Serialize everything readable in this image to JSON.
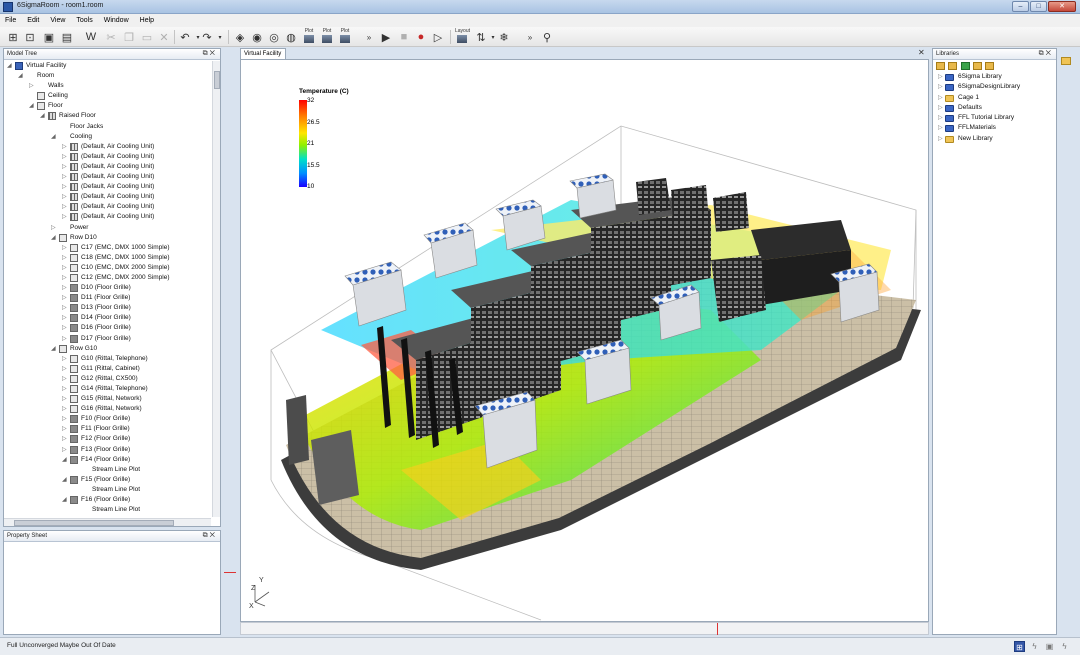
{
  "window": {
    "title": "6SigmaRoom - room1.room"
  },
  "menu": [
    "File",
    "Edit",
    "View",
    "Tools",
    "Window",
    "Help"
  ],
  "toolbar": {
    "plot_labels": [
      "Plot",
      "Plot",
      "Plot"
    ],
    "layout_label": "Layout",
    "more": "»"
  },
  "model_tree": {
    "title": "Model Tree",
    "items": [
      {
        "depth": 0,
        "arrow": "◢",
        "icon": "blue",
        "label": "Virtual Facility"
      },
      {
        "depth": 1,
        "arrow": "◢",
        "icon": "none",
        "label": "Room"
      },
      {
        "depth": 2,
        "arrow": "▷",
        "icon": "none",
        "label": "Walls"
      },
      {
        "depth": 2,
        "arrow": "",
        "icon": "plain",
        "label": "Ceiling"
      },
      {
        "depth": 2,
        "arrow": "◢",
        "icon": "plain",
        "label": "Floor"
      },
      {
        "depth": 3,
        "arrow": "◢",
        "icon": "grid",
        "label": "Raised Floor"
      },
      {
        "depth": 4,
        "arrow": "",
        "icon": "none",
        "label": "Floor Jacks"
      },
      {
        "depth": 4,
        "arrow": "◢",
        "icon": "none",
        "label": "Cooling"
      },
      {
        "depth": 5,
        "arrow": "▷",
        "icon": "grid",
        "label": "(Default, Air Cooling Unit)"
      },
      {
        "depth": 5,
        "arrow": "▷",
        "icon": "grid",
        "label": "(Default, Air Cooling Unit)"
      },
      {
        "depth": 5,
        "arrow": "▷",
        "icon": "grid",
        "label": "(Default, Air Cooling Unit)"
      },
      {
        "depth": 5,
        "arrow": "▷",
        "icon": "grid",
        "label": "(Default, Air Cooling Unit)"
      },
      {
        "depth": 5,
        "arrow": "▷",
        "icon": "grid",
        "label": "(Default, Air Cooling Unit)"
      },
      {
        "depth": 5,
        "arrow": "▷",
        "icon": "grid",
        "label": "(Default, Air Cooling Unit)"
      },
      {
        "depth": 5,
        "arrow": "▷",
        "icon": "grid",
        "label": "(Default, Air Cooling Unit)"
      },
      {
        "depth": 5,
        "arrow": "▷",
        "icon": "grid",
        "label": "(Default, Air Cooling Unit)"
      },
      {
        "depth": 4,
        "arrow": "▷",
        "icon": "none",
        "label": "Power"
      },
      {
        "depth": 4,
        "arrow": "◢",
        "icon": "plain",
        "label": "Row D10"
      },
      {
        "depth": 5,
        "arrow": "▷",
        "icon": "plain",
        "label": "C17 (EMC, DMX 1000 Simple)"
      },
      {
        "depth": 5,
        "arrow": "▷",
        "icon": "plain",
        "label": "C18 (EMC, DMX 1000 Simple)"
      },
      {
        "depth": 5,
        "arrow": "▷",
        "icon": "plain",
        "label": "C10 (EMC, DMX 2000 Simple)"
      },
      {
        "depth": 5,
        "arrow": "▷",
        "icon": "plain",
        "label": "C12 (EMC, DMX 2000 Simple)"
      },
      {
        "depth": 5,
        "arrow": "▷",
        "icon": "dark",
        "label": "D10 (Floor Grille)"
      },
      {
        "depth": 5,
        "arrow": "▷",
        "icon": "dark",
        "label": "D11 (Floor Grille)"
      },
      {
        "depth": 5,
        "arrow": "▷",
        "icon": "dark",
        "label": "D13 (Floor Grille)"
      },
      {
        "depth": 5,
        "arrow": "▷",
        "icon": "dark",
        "label": "D14 (Floor Grille)"
      },
      {
        "depth": 5,
        "arrow": "▷",
        "icon": "dark",
        "label": "D16 (Floor Grille)"
      },
      {
        "depth": 5,
        "arrow": "▷",
        "icon": "dark",
        "label": "D17 (Floor Grille)"
      },
      {
        "depth": 4,
        "arrow": "◢",
        "icon": "plain",
        "label": "Row G10"
      },
      {
        "depth": 5,
        "arrow": "▷",
        "icon": "plain",
        "label": "G10 (Rittal, Telephone)"
      },
      {
        "depth": 5,
        "arrow": "▷",
        "icon": "plain",
        "label": "G11 (Rittal, Cabinet)"
      },
      {
        "depth": 5,
        "arrow": "▷",
        "icon": "plain",
        "label": "G12 (Rittal, CX500)"
      },
      {
        "depth": 5,
        "arrow": "▷",
        "icon": "plain",
        "label": "G14 (Rittal, Telephone)"
      },
      {
        "depth": 5,
        "arrow": "▷",
        "icon": "plain",
        "label": "G15 (Rittal, Network)"
      },
      {
        "depth": 5,
        "arrow": "▷",
        "icon": "plain",
        "label": "G16 (Rittal, Network)"
      },
      {
        "depth": 5,
        "arrow": "▷",
        "icon": "dark",
        "label": "F10 (Floor Grille)"
      },
      {
        "depth": 5,
        "arrow": "▷",
        "icon": "dark",
        "label": "F11 (Floor Grille)"
      },
      {
        "depth": 5,
        "arrow": "▷",
        "icon": "dark",
        "label": "F12 (Floor Grille)"
      },
      {
        "depth": 5,
        "arrow": "▷",
        "icon": "dark",
        "label": "F13 (Floor Grille)"
      },
      {
        "depth": 5,
        "arrow": "◢",
        "icon": "dark",
        "label": "F14 (Floor Grille)"
      },
      {
        "depth": 6,
        "arrow": "",
        "icon": "none",
        "label": "Stream Line Plot"
      },
      {
        "depth": 5,
        "arrow": "◢",
        "icon": "dark",
        "label": "F15 (Floor Grille)"
      },
      {
        "depth": 6,
        "arrow": "",
        "icon": "none",
        "label": "Stream Line Plot"
      },
      {
        "depth": 5,
        "arrow": "◢",
        "icon": "dark",
        "label": "F16 (Floor Grille)"
      },
      {
        "depth": 6,
        "arrow": "",
        "icon": "none",
        "label": "Stream Line Plot"
      }
    ]
  },
  "property_sheet": {
    "title": "Property Sheet"
  },
  "viewport": {
    "tab_label": "Virtual Facility",
    "legend": {
      "title": "Temperature (C)",
      "ticks": [
        "32",
        "26.5",
        "21",
        "15.5",
        "10"
      ]
    },
    "axes": {
      "z": "Z",
      "y": "Y",
      "x": "X"
    }
  },
  "libraries": {
    "title": "Libraries",
    "items": [
      {
        "icon": "blue",
        "label": "6Sigma Library"
      },
      {
        "icon": "blue",
        "label": "6SigmaDesignLibrary"
      },
      {
        "icon": "folder",
        "label": "Cage 1"
      },
      {
        "icon": "blue",
        "label": "Defaults"
      },
      {
        "icon": "blue",
        "label": "FFL Tutorial Library"
      },
      {
        "icon": "blue",
        "label": "FFLMaterials"
      },
      {
        "icon": "folder",
        "label": "New Library"
      }
    ]
  },
  "status": {
    "text": "Full Unconverged Maybe Out Of Date"
  }
}
